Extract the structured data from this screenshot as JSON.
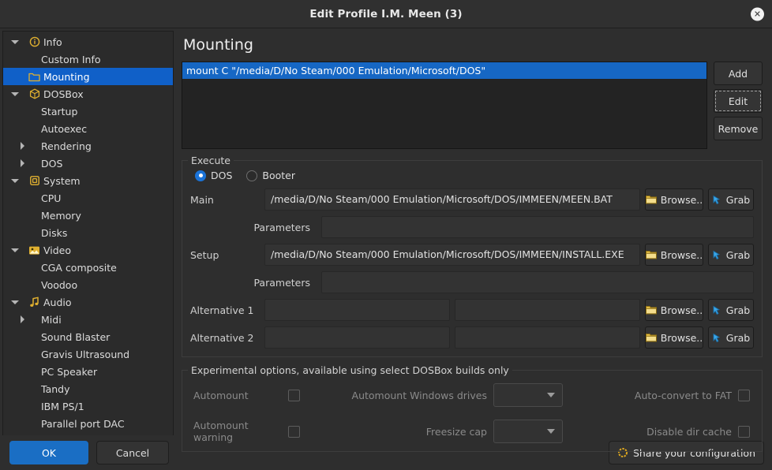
{
  "window": {
    "title": "Edit Profile I.M. Meen (3)",
    "close_icon": "close-icon"
  },
  "sidebar": {
    "items": [
      {
        "label": "Info",
        "icon": "info-circle-icon",
        "indent": 0,
        "expander": "down",
        "selected": false
      },
      {
        "label": "Custom Info",
        "icon": "",
        "indent": 1,
        "expander": "",
        "selected": false
      },
      {
        "label": "Mounting",
        "icon": "folder-icon",
        "indent": 0,
        "expander": "",
        "selected": true
      },
      {
        "label": "DOSBox",
        "icon": "box-icon",
        "indent": 0,
        "expander": "down",
        "selected": false
      },
      {
        "label": "Startup",
        "icon": "",
        "indent": 1,
        "expander": "",
        "selected": false
      },
      {
        "label": "Autoexec",
        "icon": "",
        "indent": 1,
        "expander": "",
        "selected": false
      },
      {
        "label": "Rendering",
        "icon": "",
        "indent": 1,
        "expander": "right",
        "selected": false
      },
      {
        "label": "DOS",
        "icon": "",
        "indent": 1,
        "expander": "right",
        "selected": false
      },
      {
        "label": "System",
        "icon": "chip-icon",
        "indent": 0,
        "expander": "down",
        "selected": false
      },
      {
        "label": "CPU",
        "icon": "",
        "indent": 1,
        "expander": "",
        "selected": false
      },
      {
        "label": "Memory",
        "icon": "",
        "indent": 1,
        "expander": "",
        "selected": false
      },
      {
        "label": "Disks",
        "icon": "",
        "indent": 1,
        "expander": "",
        "selected": false
      },
      {
        "label": "Video",
        "icon": "image-icon",
        "indent": 0,
        "expander": "down",
        "selected": false
      },
      {
        "label": "CGA composite",
        "icon": "",
        "indent": 1,
        "expander": "",
        "selected": false
      },
      {
        "label": "Voodoo",
        "icon": "",
        "indent": 1,
        "expander": "",
        "selected": false
      },
      {
        "label": "Audio",
        "icon": "music-note-icon",
        "indent": 0,
        "expander": "down",
        "selected": false
      },
      {
        "label": "Midi",
        "icon": "",
        "indent": 1,
        "expander": "right",
        "selected": false
      },
      {
        "label": "Sound Blaster",
        "icon": "",
        "indent": 1,
        "expander": "",
        "selected": false
      },
      {
        "label": "Gravis Ultrasound",
        "icon": "",
        "indent": 1,
        "expander": "",
        "selected": false
      },
      {
        "label": "PC Speaker",
        "icon": "",
        "indent": 1,
        "expander": "",
        "selected": false
      },
      {
        "label": "Tandy",
        "icon": "",
        "indent": 1,
        "expander": "",
        "selected": false
      },
      {
        "label": "IBM PS/1",
        "icon": "",
        "indent": 1,
        "expander": "",
        "selected": false
      },
      {
        "label": "Parallel port DAC",
        "icon": "",
        "indent": 1,
        "expander": "",
        "selected": false
      }
    ]
  },
  "main": {
    "page_title": "Mounting",
    "mount_list": {
      "rows": [
        {
          "text": "mount C \"/media/D/No Steam/000 Emulation/Microsoft/DOS\"",
          "selected": true
        }
      ]
    },
    "list_buttons": {
      "add": "Add",
      "edit": "Edit",
      "remove": "Remove"
    },
    "execute": {
      "title": "Execute",
      "mode_options": [
        {
          "label": "DOS",
          "checked": true
        },
        {
          "label": "Booter",
          "checked": false
        }
      ],
      "rows": [
        {
          "label": "Main",
          "value": "/media/D/No Steam/000 Emulation/Microsoft/DOS/IMMEEN/MEEN.BAT",
          "browse": "Browse..",
          "grab": "Grab"
        },
        {
          "label": "Parameters",
          "value": "",
          "browse": "",
          "grab": ""
        },
        {
          "label": "Setup",
          "value": "/media/D/No Steam/000 Emulation/Microsoft/DOS/IMMEEN/INSTALL.EXE",
          "browse": "Browse..",
          "grab": "Grab"
        },
        {
          "label": "Parameters",
          "value": "",
          "browse": "",
          "grab": ""
        },
        {
          "label": "Alternative 1",
          "value": "",
          "value2": "",
          "browse": "Browse..",
          "grab": "Grab"
        },
        {
          "label": "Alternative 2",
          "value": "",
          "value2": "",
          "browse": "Browse..",
          "grab": "Grab"
        }
      ]
    },
    "experimental": {
      "title": "Experimental options, available using select DOSBox builds only",
      "automount_label": "Automount",
      "automount_checked": false,
      "automount_warning_label": "Automount warning",
      "automount_warning_checked": false,
      "automount_windows_drives_label": "Automount Windows drives",
      "automount_windows_drives_value": "",
      "freesize_cap_label": "Freesize cap",
      "freesize_cap_value": "",
      "auto_convert_fat_label": "Auto-convert to FAT",
      "auto_convert_fat_checked": false,
      "disable_dir_cache_label": "Disable dir cache",
      "disable_dir_cache_checked": false
    }
  },
  "footer": {
    "ok": "OK",
    "cancel": "Cancel",
    "share": "Share your configuration",
    "share_icon": "gear-circle-icon"
  },
  "colors": {
    "accent_blue": "#1a6ec4",
    "selection_blue": "#1060c8",
    "list_selection_blue": "#1667c4",
    "icon_gold": "#e0b030",
    "window_bg": "#2e2e2e",
    "sidebar_bg": "#2b2b2b",
    "input_bg": "#333333"
  }
}
